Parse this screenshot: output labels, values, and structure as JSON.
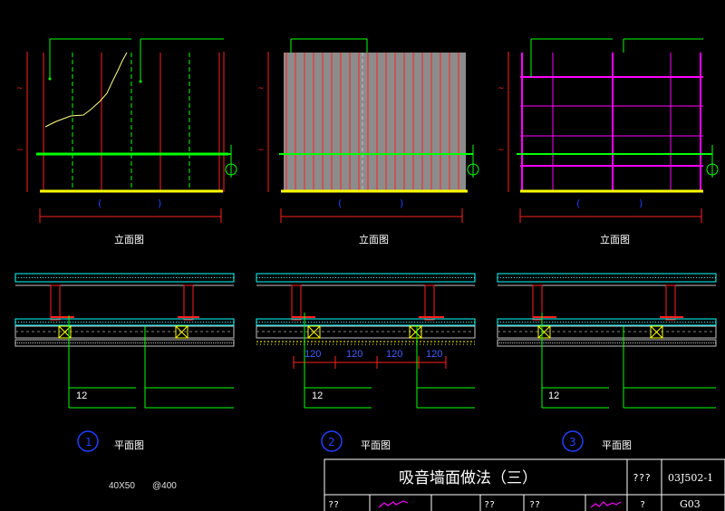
{
  "elevation_label": "立面图",
  "plan_label": "平面图",
  "circle_numbers": [
    "1",
    "2",
    "3"
  ],
  "small_circle_numbers": [
    "1",
    "2",
    "3"
  ],
  "dim_120": "120",
  "callout_12": "12",
  "stud_note_size": "40X50",
  "stud_note_spacing": "@400",
  "title_block": {
    "title": "吸音墙面做法（三）",
    "cell_atlas_label": "???",
    "atlas_number": "03J502-1",
    "row2_c1": "??",
    "row2_c2": "??",
    "row2_c3": "??",
    "row2_c4": "?",
    "page_number": "G03"
  },
  "colors": {
    "background": "#000000",
    "red": "#ff2020",
    "green": "#00ff00",
    "magenta": "#ff00ff",
    "yellow": "#ffff00",
    "cyan": "#00ffff",
    "blue": "#2040ff",
    "gray_panel": "#8c8c8c"
  }
}
